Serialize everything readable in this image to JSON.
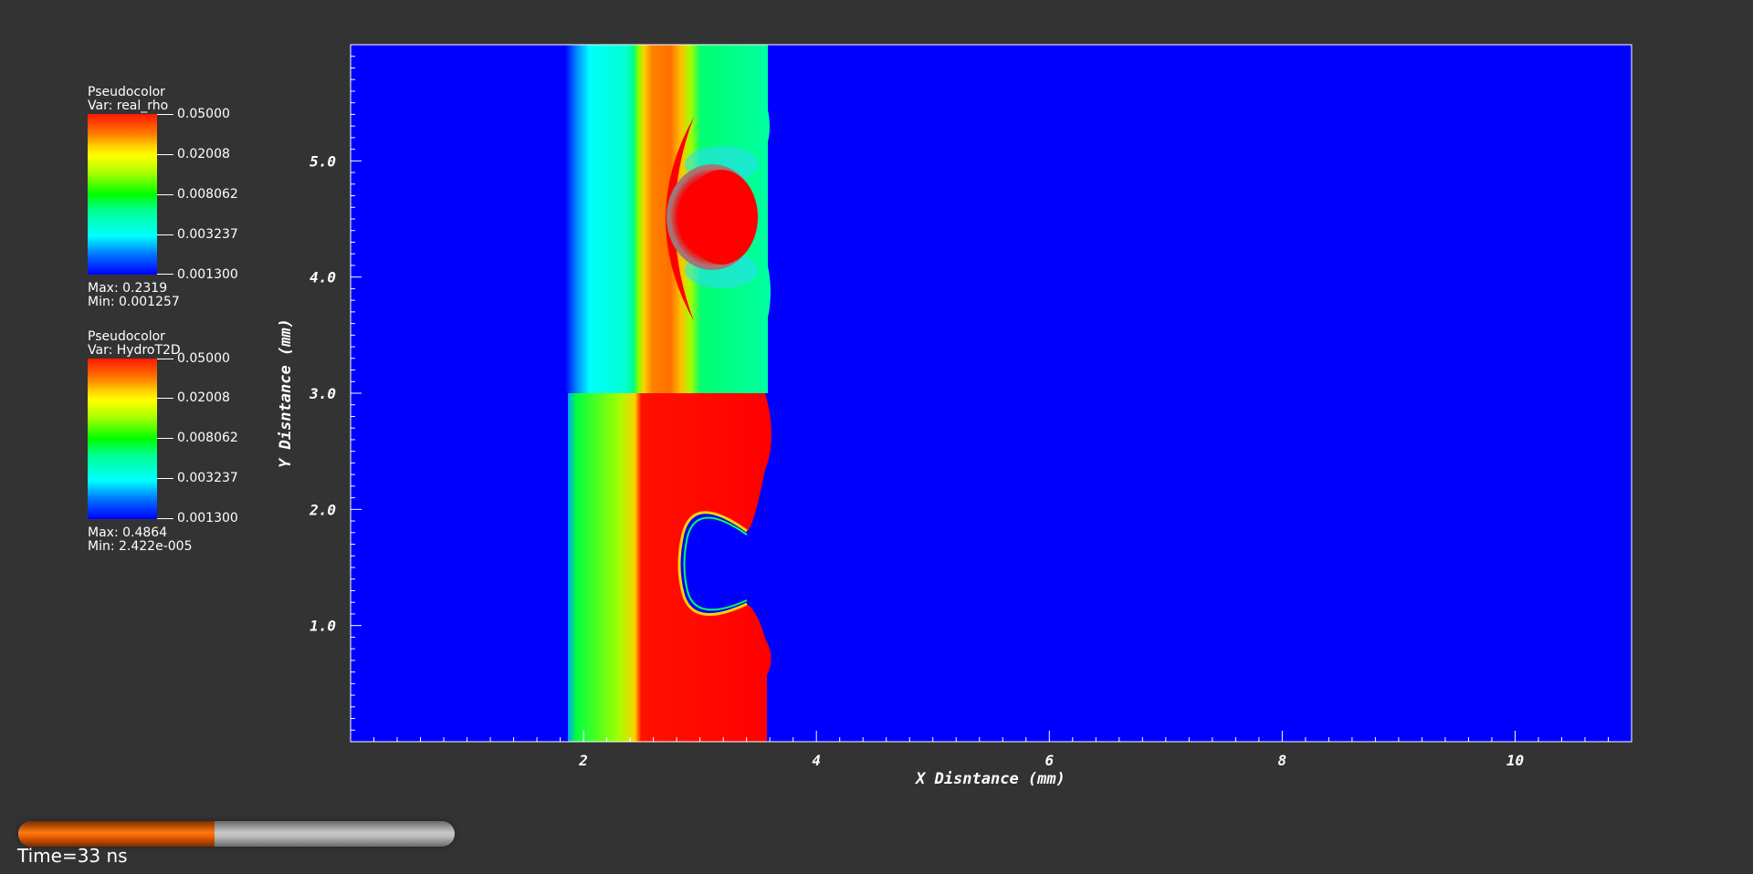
{
  "legends": [
    {
      "title": "Pseudocolor",
      "variable": "Var: real_rho",
      "tick_labels": [
        "0.05000",
        "0.02008",
        "0.008062",
        "0.003237",
        "0.001300"
      ],
      "max_text": "Max:  0.2319",
      "min_text": "Min:  0.001257"
    },
    {
      "title": "Pseudocolor",
      "variable": "Var: HydroT2D",
      "tick_labels": [
        "0.05000",
        "0.02008",
        "0.008062",
        "0.003237",
        "0.001300"
      ],
      "max_text": "Max:  0.4864",
      "min_text": "Min:  2.422e-005"
    }
  ],
  "plot": {
    "xlabel": "X Disntance (mm)",
    "ylabel": "Y Disntance (mm)",
    "x_range": [
      0,
      11
    ],
    "y_range": [
      0,
      6
    ],
    "x_ticks": [
      "2",
      "4",
      "6",
      "8",
      "10"
    ],
    "y_ticks": [
      "1.0",
      "2.0",
      "3.0",
      "4.0",
      "5.0"
    ],
    "background_color": "#0000ff"
  },
  "time_label": "Time=33 ns",
  "progress_fraction": 0.45,
  "colors": {
    "background": "#333333",
    "field_low": "#0000ff",
    "field_high": "#ff0000",
    "progress_fill": "#ff7a10",
    "progress_track": "#c0c0c0"
  }
}
